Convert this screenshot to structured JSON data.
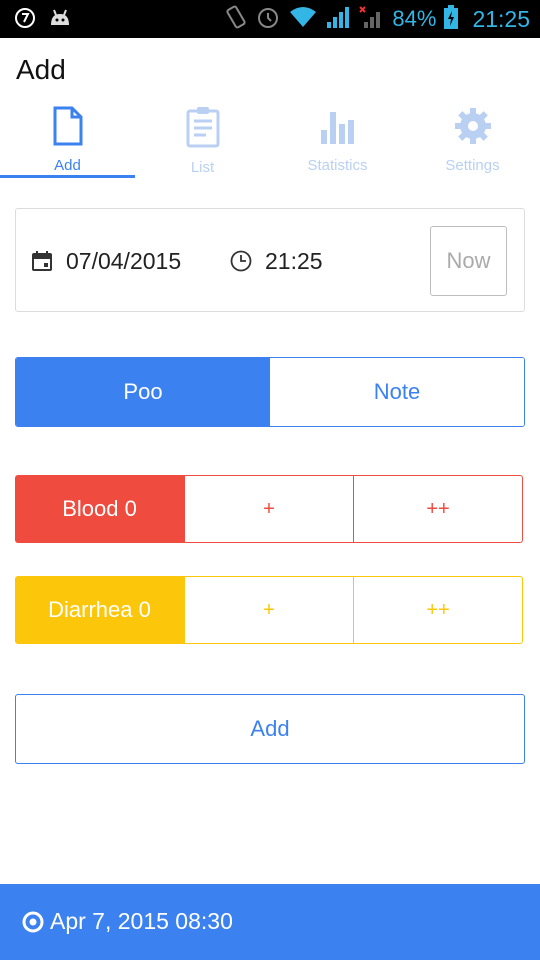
{
  "status_bar": {
    "battery_percent": "84%",
    "time": "21:25",
    "icons": [
      "clock-app-icon",
      "android-debug-icon",
      "vibrate-icon",
      "alarm-icon",
      "wifi-icon",
      "signal-icon",
      "signal-no-data-icon",
      "battery-charging-icon"
    ]
  },
  "header": {
    "title": "Add"
  },
  "tabs": [
    {
      "label": "Add",
      "icon": "document-icon",
      "active": true
    },
    {
      "label": "List",
      "icon": "clipboard-list-icon",
      "active": false
    },
    {
      "label": "Statistics",
      "icon": "bar-chart-icon",
      "active": false
    },
    {
      "label": "Settings",
      "icon": "gear-icon",
      "active": false
    }
  ],
  "datetime": {
    "date": "07/04/2015",
    "time": "21:25",
    "now_label": "Now"
  },
  "entry_type": {
    "options": [
      "Poo",
      "Note"
    ],
    "selected": "Poo"
  },
  "blood": {
    "label": "Blood 0",
    "options": [
      "+",
      "++"
    ]
  },
  "diarrhea": {
    "label": "Diarrhea 0",
    "options": [
      "+",
      "++"
    ]
  },
  "add_button": {
    "label": "Add"
  },
  "footer": {
    "text": "Apr 7, 2015 08:30"
  },
  "colors": {
    "accent": "#3b82f0",
    "blood": "#ef4b3f",
    "diarrhea": "#fcc70a",
    "status_icons": "#33b5e5"
  }
}
